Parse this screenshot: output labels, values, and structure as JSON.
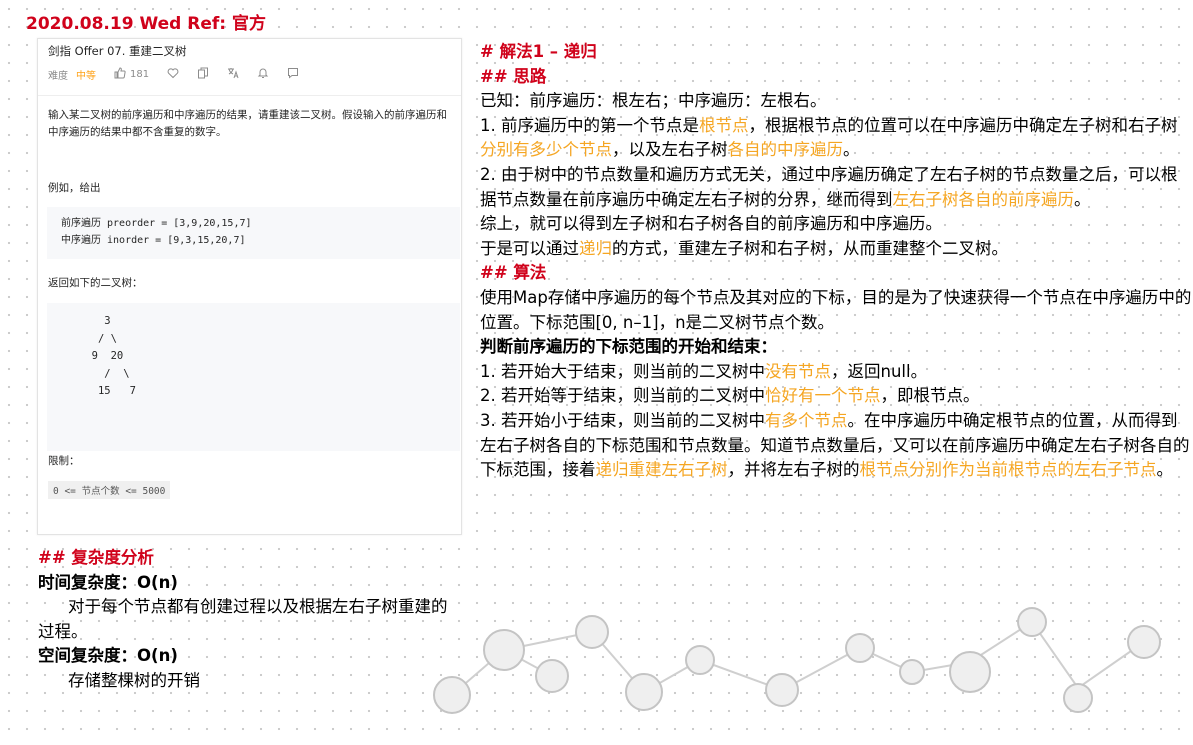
{
  "header": {
    "title": "2020.08.19 Wed Ref: 官方"
  },
  "problem": {
    "title": "剑指 Offer 07. 重建二叉树",
    "difficulty_label": "难度",
    "difficulty": "中等",
    "likes": "181",
    "description": "输入某二叉树的前序遍历和中序遍历的结果，请重建该二叉树。假设输入的前序遍历和中序遍历的结果中都不含重复的数字。",
    "example_label": "例如，给出",
    "example_preorder": "前序遍历 preorder = [3,9,20,15,7]",
    "example_inorder": "中序遍历 inorder = [9,3,15,20,7]",
    "return_label": "返回如下的二叉树：",
    "tree_lines": [
      "    3",
      "   / \\",
      "  9  20",
      "    /  \\",
      "   15   7"
    ],
    "limit_label": "限制：",
    "limit_value": "0 <= 节点个数 <= 5000"
  },
  "complexity": {
    "heading": "## 复杂度分析",
    "time_label": "时间复杂度：O(n)",
    "time_desc": "对于每个节点都有创建过程以及根据左右子树重建的过程。",
    "space_label": "空间复杂度：O(n)",
    "space_desc": "存储整棵树的开销"
  },
  "solution": {
    "heading": "# 解法1 – 递归",
    "idea_heading": "## 思路",
    "known": "已知：前序遍历：根左右；中序遍历：左根右。",
    "p1_a": "1. 前序遍历中的第一个节点是",
    "p1_hl1": "根节点",
    "p1_b": "，根据根节点的位置可以在中序遍历中确定左子树和右子树",
    "p1_hl2": "分别有多少个节点",
    "p1_c": "，以及左右子树",
    "p1_hl3": "各自的中序遍历",
    "p1_d": "。",
    "p2_a": "2. 由于树中的节点数量和遍历方式无关，通过中序遍历确定了左右子树的节点数量之后，可以根据节点数量在前序遍历中确定左右子树的分界，继而得到",
    "p2_hl": "左右子树各自的前序遍历",
    "p2_b": "。",
    "summary": "综上，就可以得到左子树和右子树各自的前序遍历和中序遍历。",
    "s2_a": "于是可以通过",
    "s2_hl": "递归",
    "s2_b": "的方式，重建左子树和右子树，从而重建整个二叉树。",
    "algo_heading": "## 算法",
    "algo_text": "使用Map存储中序遍历的每个节点及其对应的下标，目的是为了快速获得一个节点在中序遍历中的位置。下标范围[0, n–1]，n是二叉树节点个数。",
    "judge_heading": "判断前序遍历的下标范围的开始和结束：",
    "j1_a": "1. 若开始大于结束，则当前的二叉树中",
    "j1_hl": "没有节点",
    "j1_b": "，返回null。",
    "j2_a": "2. 若开始等于结束，则当前的二叉树中",
    "j2_hl": "恰好有一个节点",
    "j2_b": "，即根节点。",
    "j3_a": "3. 若开始小于结束，则当前的二叉树中",
    "j3_hl1": "有多个节点",
    "j3_b": "。在中序遍历中确定根节点的位置，从而得到左右子树各自的下标范围和节点数量。知道节点数量后，又可以在前序遍历中确定左右子树各自的下标范围，接着",
    "j3_hl2": "递归重建左右子树",
    "j3_c": "，并将左右子树的",
    "j3_hl3": "根节点分别作为当前根节点的左右子节点",
    "j3_d": "。"
  },
  "colors": {
    "heading": "#d0021b",
    "highlight": "#f5a623"
  }
}
